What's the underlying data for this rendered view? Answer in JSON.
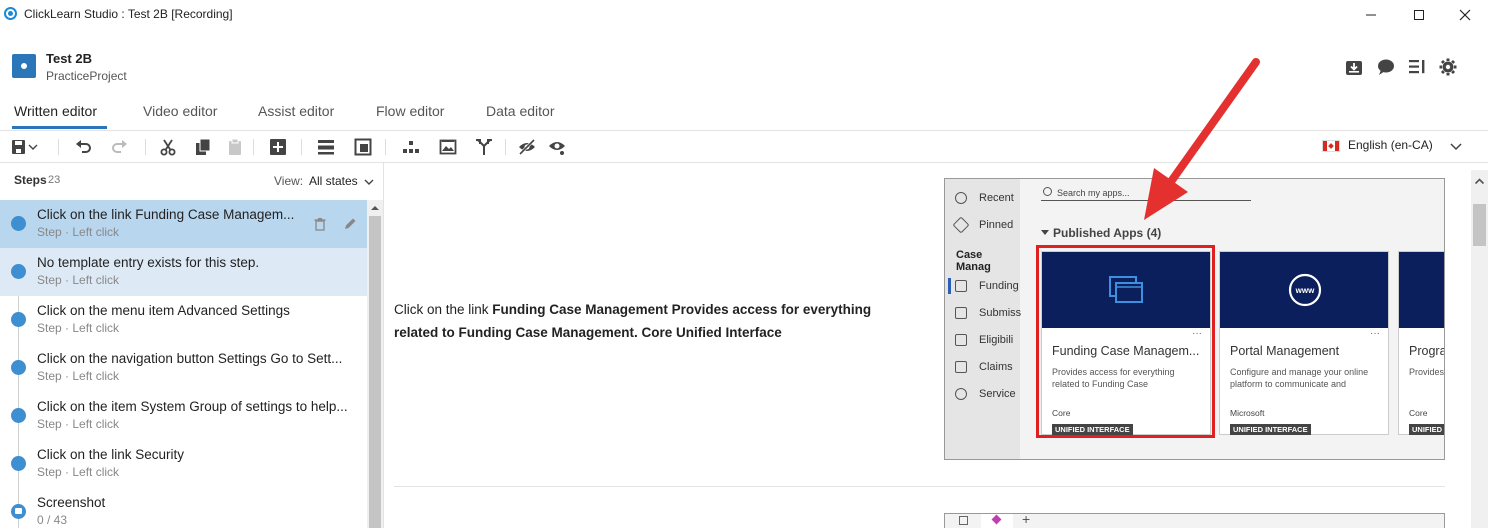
{
  "window": {
    "title": "ClickLearn Studio : Test 2B [Recording]",
    "controls": {
      "minimize": "—",
      "maximize": "☐",
      "close": "✕"
    }
  },
  "project": {
    "name": "Test 2B",
    "subtitle": "PracticeProject"
  },
  "header_icons": [
    "inbox-download-icon",
    "chat-bubble-icon",
    "list-panel-icon",
    "gear-icon"
  ],
  "tabs": [
    {
      "label": "Written editor",
      "active": true
    },
    {
      "label": "Video editor",
      "active": false
    },
    {
      "label": "Assist editor",
      "active": false
    },
    {
      "label": "Flow editor",
      "active": false
    },
    {
      "label": "Data editor",
      "active": false
    }
  ],
  "toolbar": {
    "icons": [
      "save-icon",
      "undo-icon",
      "redo-icon",
      "cut-icon",
      "copy-icon",
      "paste-icon",
      "add-step-icon",
      "insert-rows-icon",
      "insert-frame-icon",
      "hierarchy-icon",
      "screenshot-icon",
      "branch-icon",
      "hide-icon",
      "preview-icon"
    ],
    "language": "English (en-CA)"
  },
  "steps_panel": {
    "label": "Steps",
    "count": "23",
    "view_label": "View:",
    "view_value": "All states",
    "items": [
      {
        "title": "Click on the link Funding Case Managem...",
        "subtitle": "Step · Left click",
        "state": "selected"
      },
      {
        "title": "No template entry exists for this step.",
        "subtitle": "Step · Left click",
        "state": "highlight"
      },
      {
        "title": "Click on the menu item Advanced Settings",
        "subtitle": "Step · Left click",
        "state": "normal"
      },
      {
        "title": "Click on the navigation button Settings Go to Sett...",
        "subtitle": "Step · Left click",
        "state": "normal"
      },
      {
        "title": "Click on the item System Group of settings to help...",
        "subtitle": "Step · Left click",
        "state": "normal"
      },
      {
        "title": "Click on the link Security",
        "subtitle": "Step · Left click",
        "state": "normal"
      },
      {
        "title": "Screenshot",
        "subtitle": "0 / 43",
        "state": "normal"
      }
    ]
  },
  "content": {
    "prefix": "Click on the link ",
    "bold": "Funding Case Management Provides access for everything related to Funding Case Management. Core Unified Interface"
  },
  "screenshot": {
    "sidebar": [
      {
        "label": "Recent",
        "icon": "clock-icon"
      },
      {
        "label": "Pinned",
        "icon": "pin-icon"
      }
    ],
    "sidebar_section": "Case Manag",
    "sidebar_items": [
      "Funding",
      "Submiss",
      "Eligibili",
      "Claims",
      "Service"
    ],
    "search_placeholder": "Search my apps...",
    "heading": "Published Apps",
    "heading_count": "(4)",
    "cards": [
      {
        "title": "Funding Case Managem...",
        "desc": "Provides access for everything related to Funding Case",
        "publisher": "Core",
        "badge": "UNIFIED INTERFACE",
        "icon": "stacked-windows-icon"
      },
      {
        "title": "Portal Management",
        "desc": "Configure and manage your online platform to communicate and",
        "publisher": "Microsoft",
        "badge": "UNIFIED INTERFACE",
        "icon": "www-globe-icon"
      },
      {
        "title": "Progra",
        "desc": "Provides related t",
        "publisher": "Core",
        "badge": "UNIFIED",
        "icon": ""
      }
    ],
    "card_more": "···",
    "second_shot_plus": "+"
  },
  "colors": {
    "accent": "#2b76b9",
    "step_dot": "#3d8fd1",
    "selected_row": "#b9d6ef",
    "annotation_red": "#e02020",
    "card_banner": "#0b1f5c"
  }
}
